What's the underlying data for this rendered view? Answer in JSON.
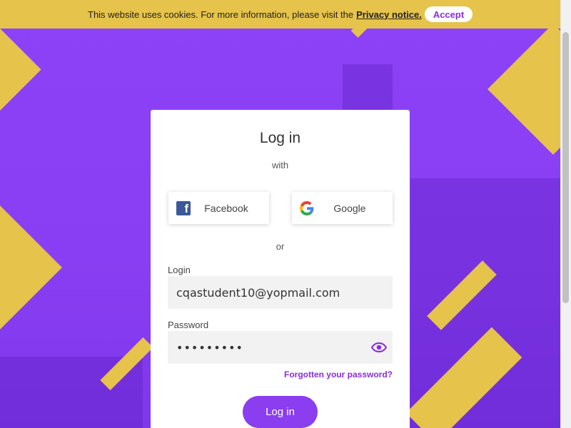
{
  "cookie_bar": {
    "text": "This website uses cookies. For more information, please visit the",
    "privacy_link": "Privacy notice.",
    "accept_label": "Accept"
  },
  "login_card": {
    "title": "Log in",
    "with_text": "with",
    "social": [
      {
        "label": "Facebook",
        "icon": "facebook-icon"
      },
      {
        "label": "Google",
        "icon": "google-icon"
      }
    ],
    "or_text": "or",
    "login_label": "Login",
    "login_value": "cqastudent10@yopmail.com",
    "password_label": "Password",
    "password_value": "•••••••••",
    "forgot_label": "Forgotten your password?",
    "submit_label": "Log in"
  },
  "colors": {
    "accent": "#8a3ef0",
    "yellow": "#e6c34a",
    "facebook": "#3b5998"
  }
}
